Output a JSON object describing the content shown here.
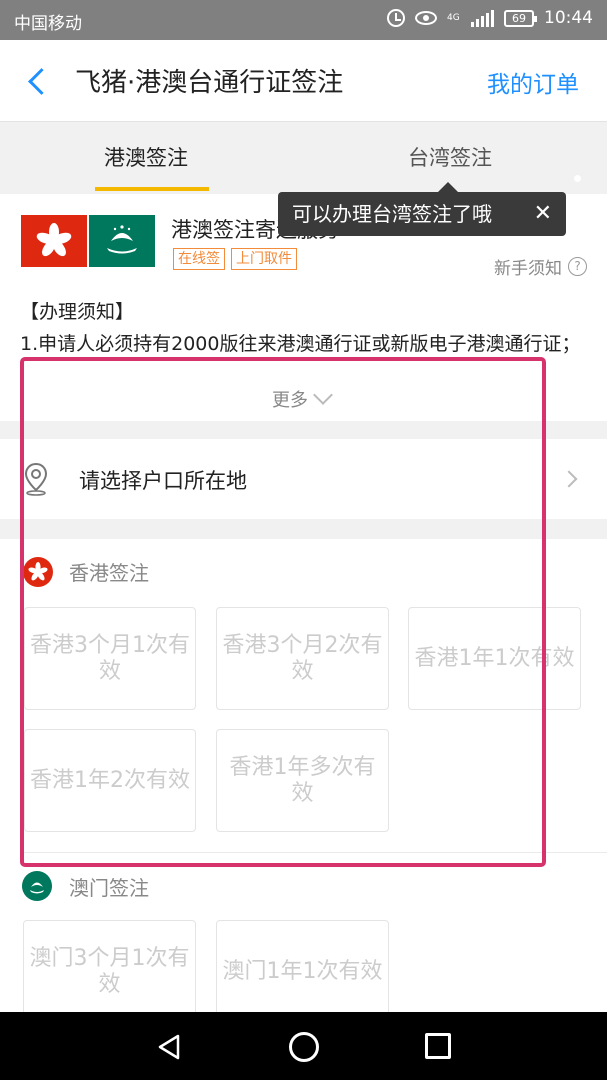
{
  "status_bar": {
    "carrier": "中国移动",
    "network": "4G",
    "battery": "69",
    "time": "10:44"
  },
  "navbar": {
    "title": "飞猪·港澳台通行证签注",
    "order_link": "我的订单"
  },
  "tabs": [
    {
      "label": "港澳签注",
      "active": true
    },
    {
      "label": "台湾签注",
      "active": false
    }
  ],
  "tooltip": {
    "text": "可以办理台湾签注了哦",
    "close_symbol": "✕"
  },
  "service": {
    "title": "港澳签注寄送服务",
    "badges": [
      "在线签",
      "上门取件"
    ],
    "guide_link": "新手须知",
    "guide_icon": "?"
  },
  "notice": {
    "title": "【办理须知】",
    "text": "1.申请人必须持有2000版往来港澳通行证或新版电子港澳通行证；",
    "more": "更多"
  },
  "residence": {
    "label": "请选择户口所在地"
  },
  "sections": [
    {
      "title": "香港签注",
      "options": [
        "香港3个月1次有效",
        "香港3个月2次有效",
        "香港1年1次有效",
        "香港1年2次有效",
        "香港1年多次有效"
      ]
    },
    {
      "title": "澳门签注",
      "options": [
        "澳门3个月1次有效",
        "澳门1年1次有效"
      ]
    }
  ],
  "colors": {
    "accent_blue": "#1e90ff",
    "tab_underline": "#f5b800",
    "badge_orange": "#f28b3a",
    "highlight_box": "#d6336c",
    "hk_red": "#de2910",
    "macau_green": "#00785e"
  }
}
